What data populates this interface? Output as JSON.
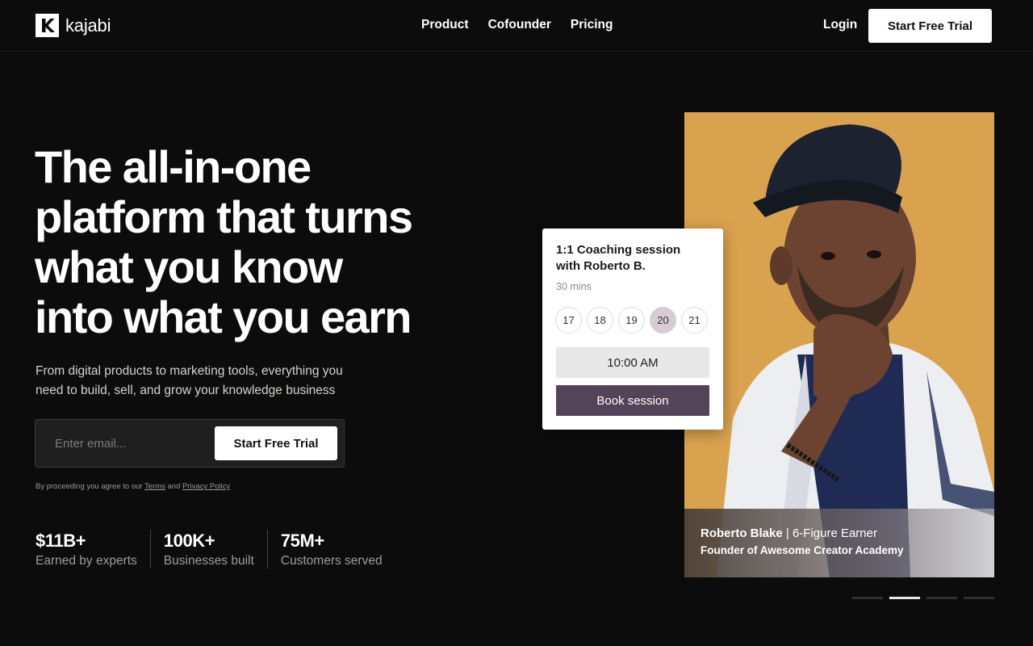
{
  "header": {
    "logo_text": "kajabi",
    "nav": [
      {
        "label": "Product"
      },
      {
        "label": "Cofounder"
      },
      {
        "label": "Pricing"
      }
    ],
    "login_label": "Login",
    "cta_label": "Start Free Trial"
  },
  "hero": {
    "title_lines": [
      "The all-in-one",
      "platform that turns",
      "what you know",
      "into what you earn"
    ],
    "subtitle_lines": [
      "From digital products to marketing tools, everything you",
      "need to build, sell, and grow your knowledge business"
    ],
    "email_placeholder": "Enter email...",
    "email_cta": "Start Free Trial",
    "legal_prefix": "By proceeding you agree to our",
    "legal_terms": "Terms",
    "legal_and": "and",
    "legal_privacy": "Privacy Policy"
  },
  "stats": [
    {
      "value": "$11B+",
      "label": "Earned by experts"
    },
    {
      "value": "100K+",
      "label": "Businesses built"
    },
    {
      "value": "75M+",
      "label": "Customers served"
    }
  ],
  "booking": {
    "title_lines": [
      "1:1 Coaching session",
      "with Roberto B."
    ],
    "duration": "30 mins",
    "dates": [
      "17",
      "18",
      "19",
      "20",
      "21"
    ],
    "selected_date": "20",
    "time_slot": "10:00 AM",
    "book_label": "Book session"
  },
  "testimonial": {
    "name": "Roberto Blake",
    "separator": " | ",
    "title": "6-Figure Earner",
    "role": "Founder of Awesome Creator Academy"
  },
  "carousel": {
    "slides": 4,
    "active_index": 1
  },
  "colors": {
    "background": "#0c0c0c",
    "photo_bg": "#d9a24f",
    "book_button": "#544459",
    "selected_date": "#d8cbd6"
  },
  "icons": {
    "logo": "kajabi-k-logo-icon"
  }
}
